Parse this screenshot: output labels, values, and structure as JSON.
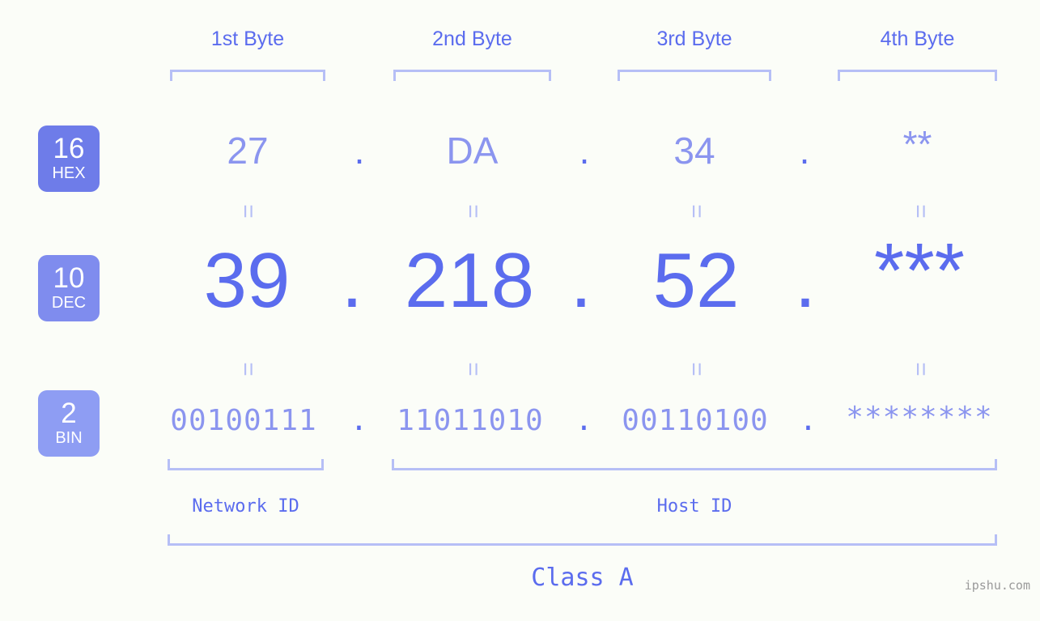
{
  "page": {
    "background_color": "#fbfdf8",
    "accent_color": "#5b6cee",
    "accent_light_color": "#8b95ef",
    "bracket_color": "#b6bff6",
    "watermark": "ipshu.com"
  },
  "byte_headers": [
    {
      "label": "1st Byte"
    },
    {
      "label": "2nd Byte"
    },
    {
      "label": "3rd Byte"
    },
    {
      "label": "4th Byte"
    }
  ],
  "bases": [
    {
      "number": "16",
      "abbr": "HEX",
      "badge_color": "#6e7ce9"
    },
    {
      "number": "10",
      "abbr": "DEC",
      "badge_color": "#7f8cee"
    },
    {
      "number": "2",
      "abbr": "BIN",
      "badge_color": "#8e9df3"
    }
  ],
  "rows": {
    "hex": {
      "base_number": "16",
      "base_abbr": "HEX",
      "values": [
        "27",
        "DA",
        "34",
        "**"
      ],
      "separator": "."
    },
    "dec": {
      "base_number": "10",
      "base_abbr": "DEC",
      "values": [
        "39",
        "218",
        "52",
        "***"
      ],
      "separator": "."
    },
    "bin": {
      "base_number": "2",
      "base_abbr": "BIN",
      "values": [
        "00100111",
        "11011010",
        "00110100",
        "********"
      ],
      "separator": "."
    }
  },
  "equality_separators": [
    "=",
    "=",
    "=",
    "=",
    "=",
    "=",
    "=",
    "="
  ],
  "id_sections": [
    {
      "label": "Network ID"
    },
    {
      "label": "Host ID"
    }
  ],
  "class": {
    "label": "Class A"
  }
}
